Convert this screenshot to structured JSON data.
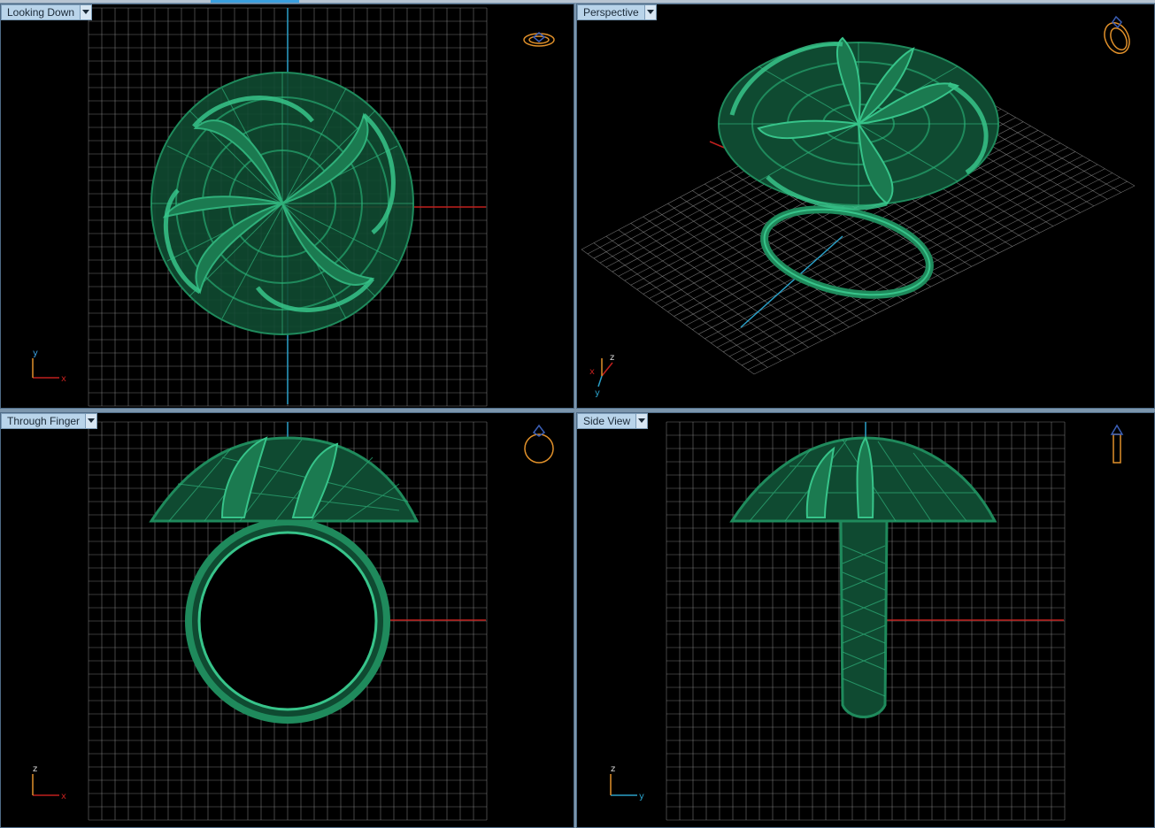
{
  "viewports": {
    "top_left": {
      "label": "Looking Down",
      "axes": [
        "y",
        "x"
      ]
    },
    "top_right": {
      "label": "Perspective",
      "axes": [
        "z",
        "x",
        "y"
      ]
    },
    "bottom_left": {
      "label": "Through Finger",
      "axes": [
        "z",
        "x"
      ]
    },
    "bottom_right": {
      "label": "Side View",
      "axes": [
        "z",
        "y"
      ]
    }
  },
  "icons": {
    "top_left": "ring-top-view-icon",
    "top_right": "ring-perspective-icon",
    "bottom_left": "ring-front-view-icon",
    "bottom_right": "ring-side-view-icon",
    "dropdown": "chevron-down-icon"
  },
  "colors": {
    "model_green": "#1f8a5c",
    "grid": "#9a9a9a",
    "axis_x": "#c0201e",
    "axis_y": "#2aa0c8",
    "icon_orange": "#e0902a",
    "icon_blue": "#3b5fb6",
    "tab_bg": "#b9d4ea"
  }
}
